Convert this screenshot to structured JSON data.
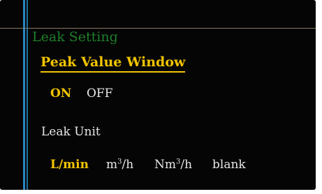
{
  "heading": "Leak Setting",
  "peak_section": {
    "title": "Peak Value Window",
    "options": [
      {
        "label": "ON",
        "selected": true
      },
      {
        "label": "OFF",
        "selected": false
      }
    ]
  },
  "unit_section": {
    "label": "Leak Unit",
    "options": [
      {
        "label": "L/min",
        "selected": true
      },
      {
        "base": "m",
        "sup": "3",
        "suffix": "/h",
        "selected": false
      },
      {
        "base": "Nm",
        "sup": "3",
        "suffix": "/h",
        "selected": false
      },
      {
        "label": "blank",
        "selected": false
      }
    ]
  },
  "colors": {
    "background": "#050505",
    "accent_yellow": "#f2c400",
    "heading_green": "#1f7f2a",
    "bar_blue": "#2a86c2",
    "text_white": "#e8e8e8"
  }
}
